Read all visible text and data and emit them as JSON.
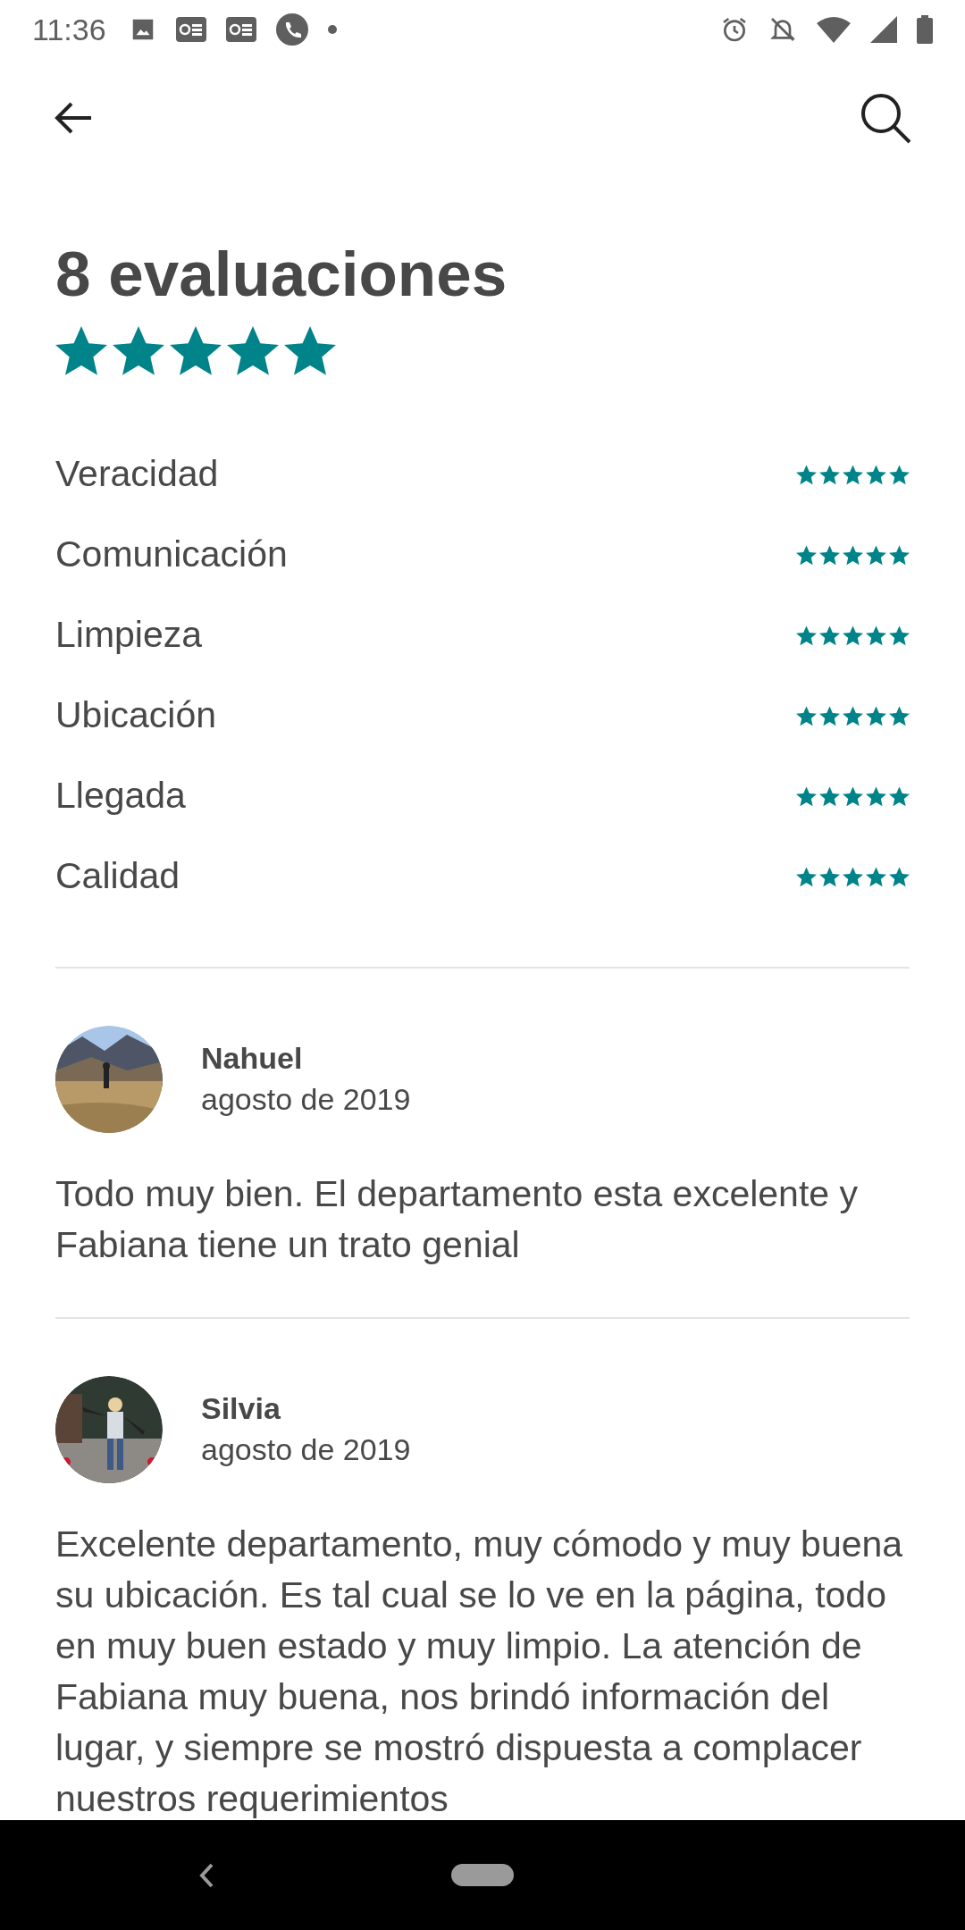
{
  "status_bar": {
    "time": "11:36"
  },
  "title": "8 evaluaciones",
  "overall": {
    "stars": 5
  },
  "categories": [
    {
      "label": "Veracidad",
      "stars": 5
    },
    {
      "label": "Comunicación",
      "stars": 5
    },
    {
      "label": "Limpieza",
      "stars": 5
    },
    {
      "label": "Ubicación",
      "stars": 5
    },
    {
      "label": "Llegada",
      "stars": 5
    },
    {
      "label": "Calidad",
      "stars": 5
    }
  ],
  "reviews": [
    {
      "name": "Nahuel",
      "date": "agosto de 2019",
      "text": "Todo muy bien. El departamento esta excelente y Fabiana tiene un trato genial"
    },
    {
      "name": "Silvia",
      "date": "agosto de 2019",
      "text": "Excelente departamento, muy cómodo y muy buena su ubicación. Es tal cual se lo ve en la página, todo en muy buen estado y muy limpio. La atención de Fabiana muy buena, nos brindó información del lugar, y siempre se mostró dispuesta a complacer nuestros requerimientos"
    }
  ]
}
